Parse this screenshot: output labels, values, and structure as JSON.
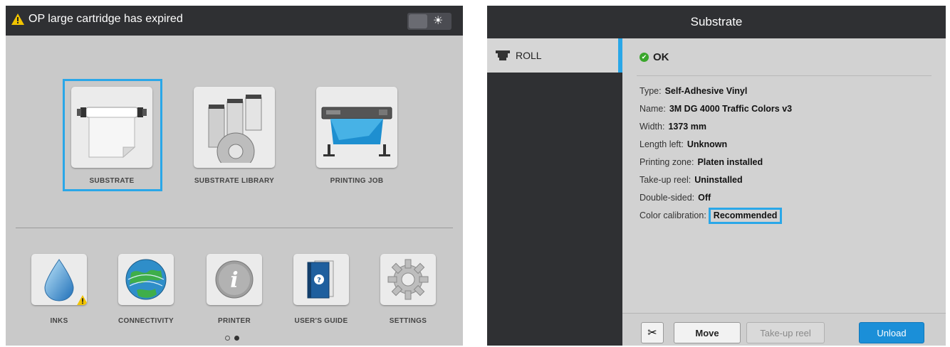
{
  "left_screen": {
    "alert_text": "OP large cartridge has expired",
    "alert_icon": "warning-icon",
    "theme_toggle_icon": "sun-icon",
    "main_tiles": [
      {
        "label": "SUBSTRATE",
        "icon": "substrate-roll-icon",
        "selected": true
      },
      {
        "label": "SUBSTRATE LIBRARY",
        "icon": "substrate-library-icon",
        "selected": false
      },
      {
        "label": "PRINTING JOB",
        "icon": "printer-job-icon",
        "selected": false
      }
    ],
    "bottom_tiles": [
      {
        "label": "INKS",
        "icon": "ink-drop-icon",
        "warning": true
      },
      {
        "label": "CONNECTIVITY",
        "icon": "globe-icon",
        "warning": false
      },
      {
        "label": "PRINTER",
        "icon": "info-icon",
        "warning": false
      },
      {
        "label": "USER'S GUIDE",
        "icon": "guide-book-icon",
        "warning": false
      },
      {
        "label": "SETTINGS",
        "icon": "gear-icon",
        "warning": false
      }
    ],
    "page_indicator": {
      "pages": 2,
      "current": 2
    }
  },
  "right_screen": {
    "title": "Substrate",
    "sidebar": {
      "item_label": "ROLL",
      "item_icon": "roll-icon"
    },
    "status": "OK",
    "properties": [
      {
        "label": "Type:",
        "value": "Self-Adhesive Vinyl"
      },
      {
        "label": "Name:",
        "value": "3M DG 4000 Traffic Colors v3"
      },
      {
        "label": "Width:",
        "value": "1373 mm"
      },
      {
        "label": "Length left:",
        "value": "Unknown"
      },
      {
        "label": "Printing zone:",
        "value": "Platen installed"
      },
      {
        "label": "Take-up reel:",
        "value": "Uninstalled"
      },
      {
        "label": "Double-sided:",
        "value": "Off"
      }
    ],
    "color_calibration": {
      "label": "Color calibration:",
      "value": "Recommended"
    },
    "footer": {
      "cut_icon": "scissors-icon",
      "move_label": "Move",
      "takeup_label": "Take-up reel",
      "unload_label": "Unload"
    }
  },
  "colors": {
    "accent": "#2aa7e8",
    "header": "#2f3033",
    "panel": "#c9c9c9",
    "ok_green": "#3aa62c",
    "unload_blue": "#1b8fd8",
    "warning_yellow": "#f2c400"
  }
}
